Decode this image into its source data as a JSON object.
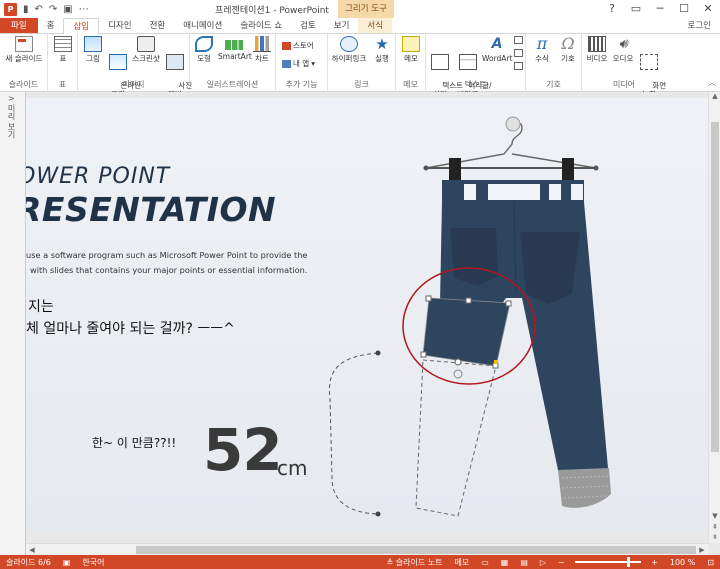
{
  "titlebar": {
    "app_icon_letter": "P",
    "undo_glyph": "↶",
    "redo_glyph": "↷",
    "present_glyph": "▣",
    "qat_more_glyph": "⋯",
    "window_title": "프레젠테이션1 - PowerPoint",
    "context_header": "그리기 도구",
    "help_glyph": "?",
    "restore_glyph": "▭",
    "minimize_glyph": "─",
    "maximize_glyph": "☐",
    "close_glyph": "✕"
  },
  "tabs": {
    "file": "파일",
    "home": "홈",
    "insert": "삽입",
    "design": "디자인",
    "transitions": "전환",
    "animations": "애니메이션",
    "slideshow": "슬라이드 쇼",
    "review": "검토",
    "view": "보기",
    "format": "서식",
    "login": "로그인"
  },
  "ribbon": {
    "slides": {
      "new_slide": "새 슬라이드",
      "group": "슬라이드"
    },
    "tables": {
      "table": "표",
      "group": "표"
    },
    "images": {
      "picture": "그림",
      "online_picture": "온라인\n그림",
      "screenshot": "스크린샷",
      "album": "사진\n앨범",
      "group": "이미지"
    },
    "illustrations": {
      "shapes": "도형",
      "smartart": "SmartArt",
      "chart": "차트",
      "group": "일러스트레이션"
    },
    "addins": {
      "store": "스토어",
      "my_apps": "내 앱",
      "group": "추가 기능"
    },
    "links": {
      "hyperlink": "하이퍼링크",
      "action": "실행",
      "group": "링크"
    },
    "comments": {
      "comment": "메모",
      "group": "메모"
    },
    "text": {
      "textbox": "텍스트\n상자",
      "header_footer": "머리글/\n바닥글",
      "wordart": "WordArt",
      "group": "텍스트"
    },
    "symbols": {
      "equation": "수식",
      "symbol": "기호",
      "group": "기호"
    },
    "media": {
      "video": "비디오",
      "audio": "오디오",
      "screen_recording": "화면\n녹화",
      "group": "미디어"
    }
  },
  "thumbnail_pane": {
    "title": "미리 보기",
    "expand_glyph": ">"
  },
  "slide": {
    "title_line1": "OWER POINT",
    "title_line2": "RESENTATION",
    "body_line1": "use a software program such as Microsoft Power Point to provide the",
    "body_line2": "with slides that contains your major points or essential information.",
    "korean_line1": "지는",
    "korean_line2": "체 얼마나 줄여야 되는 걸까? ㅡㅡ^",
    "small_label": "한~ 이 만큼??!!",
    "measurement_number": "52",
    "measurement_unit": "cm"
  },
  "colors": {
    "accent": "#d24726",
    "jeans": "#2e4560",
    "jeans_dark": "#273a52",
    "title_text": "#1f3247",
    "highlight_circle": "#b3161d"
  },
  "statusbar": {
    "slide_info": "슬라이드 6/6",
    "language": "한국어",
    "notes": "≙ 슬라이드 노트",
    "comments": "메모",
    "zoom": "100 %"
  }
}
